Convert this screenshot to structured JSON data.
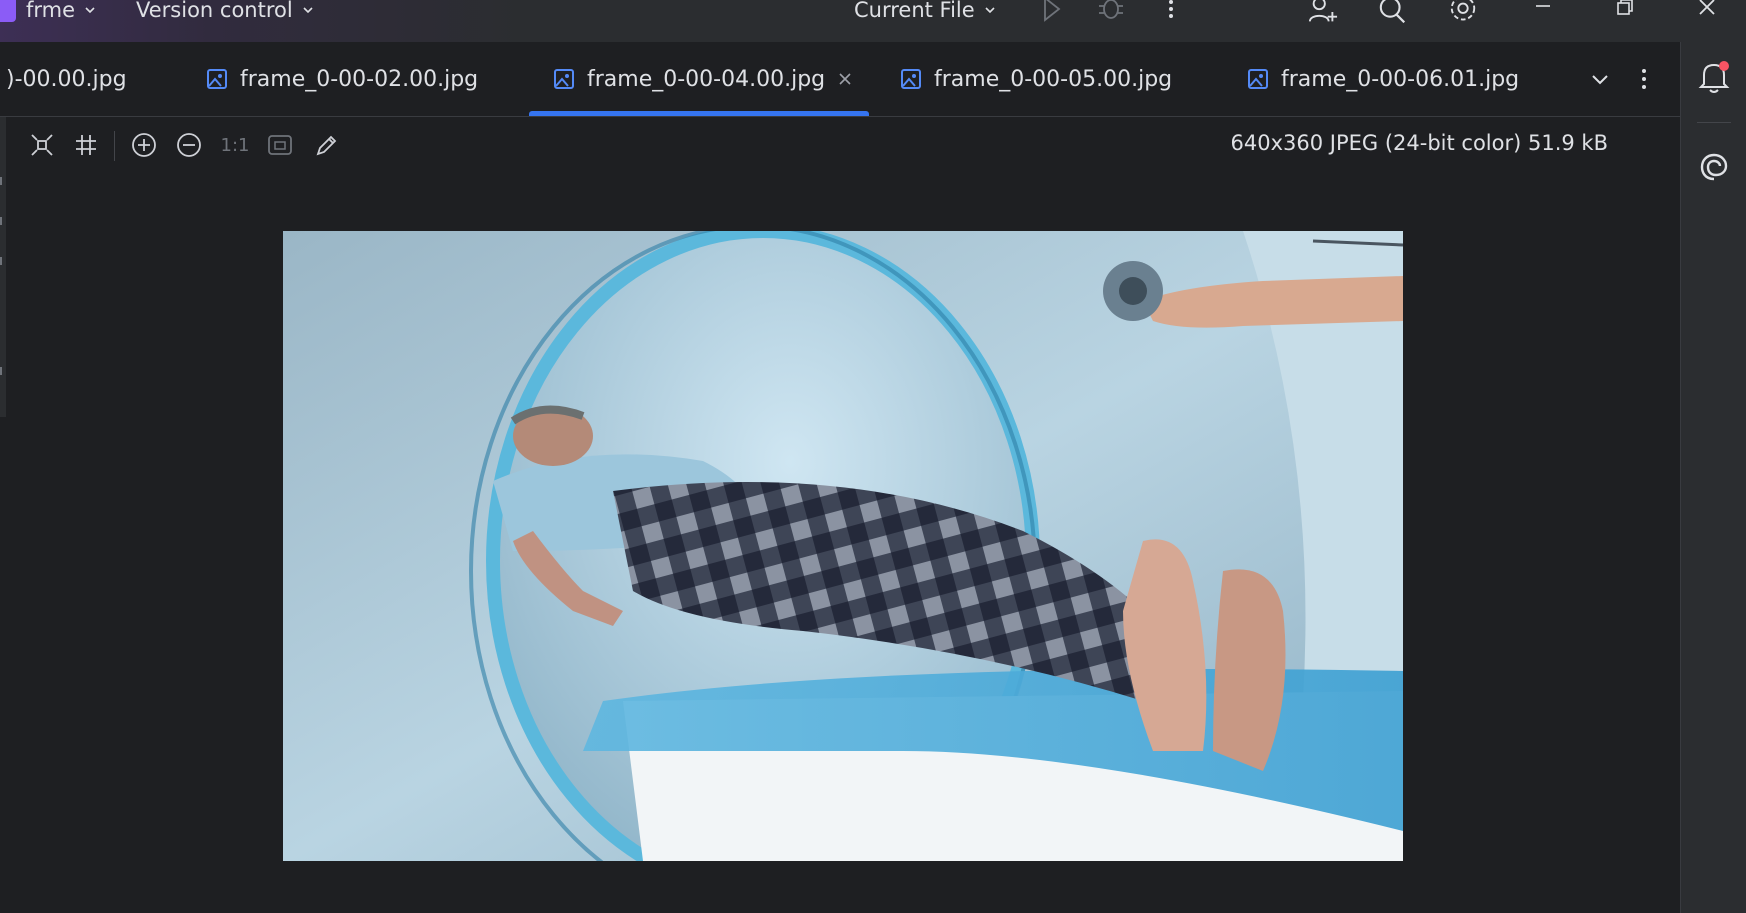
{
  "titlebar": {
    "project": "frme",
    "version_control": "Version control",
    "run_config": "Current File"
  },
  "tabs": [
    {
      "label": ")-00.00.jpg",
      "active": false
    },
    {
      "label": "frame_0-00-02.00.jpg",
      "active": false
    },
    {
      "label": "frame_0-00-04.00.jpg",
      "active": true
    },
    {
      "label": "frame_0-00-05.00.jpg",
      "active": false
    },
    {
      "label": "frame_0-00-06.01.jpg",
      "active": false
    }
  ],
  "toolbar": {
    "actual_size": "1:1"
  },
  "image_info": "640x360 JPEG (24-bit color) 51.9 kB",
  "colors": {
    "accent": "#3574f0",
    "background": "#1e1f22",
    "panel": "#2b2d30",
    "project_badge": "#8b5cf6",
    "notification_dot": "#f75464"
  },
  "icons": [
    "chevron-down-icon",
    "run-icon",
    "debug-icon",
    "more-vertical-icon",
    "add-user-icon",
    "search-icon",
    "gear-icon",
    "minimize-icon",
    "restore-icon",
    "close-icon",
    "image-file-icon",
    "fit-icon",
    "grid-icon",
    "zoom-in-icon",
    "zoom-out-icon",
    "fit-window-icon",
    "color-picker-icon",
    "notifications-icon",
    "ai-assistant-icon"
  ]
}
